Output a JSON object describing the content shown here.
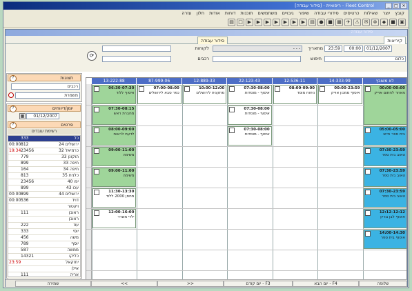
{
  "window": {
    "title": "ריפואית - [סידור עבודה] - Fleet Control",
    "controls": [
      "_",
      "□",
      "×"
    ]
  },
  "menu": [
    "קובץ",
    "יוצר",
    "שאילות",
    "כרטיסים",
    "סידורי עבודה",
    "שיפור",
    "גיבויים",
    "משתמשים",
    "תוכנות",
    "דוחות",
    "אודות",
    "חלון",
    "עזרה"
  ],
  "toolbar": [
    "▣",
    "■",
    "◆",
    "⊗",
    "✉",
    "⚠",
    "✈",
    "▦",
    "■",
    "●",
    "▤",
    "▶",
    "▶",
    "▶",
    "▶",
    "▶",
    "▶",
    "▶",
    "□",
    "▤"
  ],
  "child": {
    "title": "סידור עבודה",
    "tabs": [
      "קיריאות",
      "סידור עבודה"
    ]
  },
  "form": {
    "from_label": "מתאריך",
    "from_date": "01/12/2007",
    "from_time": "00:00",
    "to_time": "23:59",
    "vehicle_label": "לקוחות",
    "vehicle_value": "- - -",
    "driver_label": "רכבים",
    "search_label": "חיפוש",
    "clients_value": "כלום",
    "extra_label": "חיפוש"
  },
  "left_top": {
    "head": "תצוגות",
    "field1": "רכבים",
    "field2": "משמרת"
  },
  "left_mid": {
    "head": "יומן/דיווחים",
    "date": "01/12/2007",
    "sub_head": "פרטים",
    "sub_head2": "רשימת עובדים"
  },
  "legend": [
    {
      "a": "",
      "b": "333",
      "c": "כל"
    },
    {
      "a": "00:00",
      "b": "812",
      "c": "24 ירושלים"
    },
    {
      "a": "19:34",
      "b": "23456",
      "c": "32 כרמיאל"
    },
    {
      "a": "",
      "b": "779",
      "c": "33 הוקונן"
    },
    {
      "a": "",
      "b": "899",
      "c": "33 חיפה"
    },
    {
      "a": "",
      "b": "164",
      "c": "34 חיפה"
    },
    {
      "a": "",
      "b": "813",
      "c": "35 כלנית"
    },
    {
      "a": "",
      "b": "23456",
      "c": "40 יפו"
    },
    {
      "a": "",
      "b": "899",
      "c": "43 עכו"
    },
    {
      "a": "00:00",
      "b": "899",
      "c": "44 ירושלים"
    },
    {
      "a": "00:00",
      "b": "536",
      "c": "דויד"
    },
    {
      "a": "",
      "b": "",
      "c": "ויקטור"
    },
    {
      "a": "",
      "b": "111",
      "c": "ראובן"
    },
    {
      "a": "",
      "b": "",
      "c": "ראובן"
    },
    {
      "a": "",
      "b": "222",
      "c": "עוז"
    },
    {
      "a": "",
      "b": "333",
      "c": "יוסי"
    },
    {
      "a": "",
      "b": "456",
      "c": "משה"
    },
    {
      "a": "",
      "b": "789",
      "c": "יוסף"
    },
    {
      "a": "",
      "b": "587",
      "c": "ממשה"
    },
    {
      "a": "",
      "b": "14321",
      "c": "כליקו"
    },
    {
      "a": "23:59",
      "b": "",
      "c": "יחזקאל"
    },
    {
      "a": "",
      "b": "",
      "c": "אילן"
    },
    {
      "a": "",
      "b": "111",
      "c": "אריה"
    }
  ],
  "columns": [
    "לא משובץ",
    "14-333-99",
    "12-536-11",
    "22-123-43",
    "12-889-33",
    "87-999-06",
    "13-222-88"
  ],
  "appointments": [
    {
      "col": 0,
      "row": 0,
      "span": 2,
      "color": "#9fd59a",
      "time": "00:00-00:00",
      "text": "מאחר לחתום אוייק"
    },
    {
      "col": 0,
      "row": 2,
      "span": 1,
      "color": "#3bb3e3",
      "time": "05:00-05:00",
      "text": "בית ספר חייש"
    },
    {
      "col": 0,
      "row": 3,
      "span": 1,
      "color": "#3bb3e3",
      "time": "07:30-23:59",
      "text": "טאוב בית ספר"
    },
    {
      "col": 0,
      "row": 4,
      "span": 1,
      "color": "#3bb3e3",
      "time": "07:30-23:59",
      "text": "טאוב בית ספר"
    },
    {
      "col": 0,
      "row": 5,
      "span": 1,
      "color": "#3bb3e3",
      "time": "07:30-23:59",
      "text": "טאוב בית ספר"
    },
    {
      "col": 0,
      "row": 6,
      "span": 1,
      "color": "#3bb3e3",
      "time": "12:12-12:12",
      "text": "איסוף לבן גוריון"
    },
    {
      "col": 0,
      "row": 7,
      "span": 1,
      "color": "#3bb3e3",
      "time": "14:00-14:30",
      "text": "איסוף בית ספר"
    },
    {
      "col": 1,
      "row": 0,
      "span": 1,
      "color": "#ffffff",
      "time": "00:00-23:59",
      "text": "איסוף ממכון אוייק"
    },
    {
      "col": 2,
      "row": 0,
      "span": 1,
      "color": "#ffffff",
      "time": "08:00-09:00",
      "text": "ניחוח מוסד"
    },
    {
      "col": 3,
      "row": 0,
      "span": 1,
      "color": "#ffffff",
      "time": "07:30-08:00",
      "text": "איסוף - מוסדות"
    },
    {
      "col": 3,
      "row": 1,
      "span": 1,
      "color": "#ffffff",
      "time": "07:30-08:00",
      "text": "איסוף - מוסדות"
    },
    {
      "col": 3,
      "row": 2,
      "span": 1,
      "color": "#ffffff",
      "time": "07:30-08:00",
      "text": "איסוף - מוסדות"
    },
    {
      "col": 4,
      "row": 0,
      "span": 1,
      "color": "#ffffff",
      "time": "10:00-12:00",
      "text": "מתקנית לירושלים"
    },
    {
      "col": 5,
      "row": 0,
      "span": 1,
      "color": "#ffffff",
      "time": "07:00-08:00",
      "text": "כפר סבא לירושלים"
    },
    {
      "col": 6,
      "row": 0,
      "span": 1,
      "color": "#9fd59a",
      "time": "06:30-07:30",
      "text": "איסוף ללוד"
    },
    {
      "col": 6,
      "row": 1,
      "span": 1,
      "color": "#9fd59a",
      "time": "07:30-08:15",
      "text": "מחברת ראש"
    },
    {
      "col": 6,
      "row": 2,
      "span": 1,
      "color": "#9fd59a",
      "time": "08:00-09:00",
      "text": "לדעת לראות"
    },
    {
      "col": 6,
      "row": 3,
      "span": 1,
      "color": "#9fd59a",
      "time": "09:00-11:00",
      "text": "משימה"
    },
    {
      "col": 6,
      "row": 4,
      "span": 1,
      "color": "#9fd59a",
      "time": "09:00-11:00",
      "text": "משימה"
    },
    {
      "col": 6,
      "row": 5,
      "span": 1,
      "color": "#ffffff",
      "time": "11:30-13:30",
      "text": "מחסן 2000 ללוד"
    },
    {
      "col": 6,
      "row": 6,
      "span": 1,
      "color": "#ffffff",
      "time": "12:00-16:00",
      "text": "ילדי משרד"
    }
  ],
  "bottom_buttons": [
    "שלופה",
    "יום הבא - F4",
    "יום קודם - F3",
    ">>",
    "<<",
    "שמירה"
  ]
}
